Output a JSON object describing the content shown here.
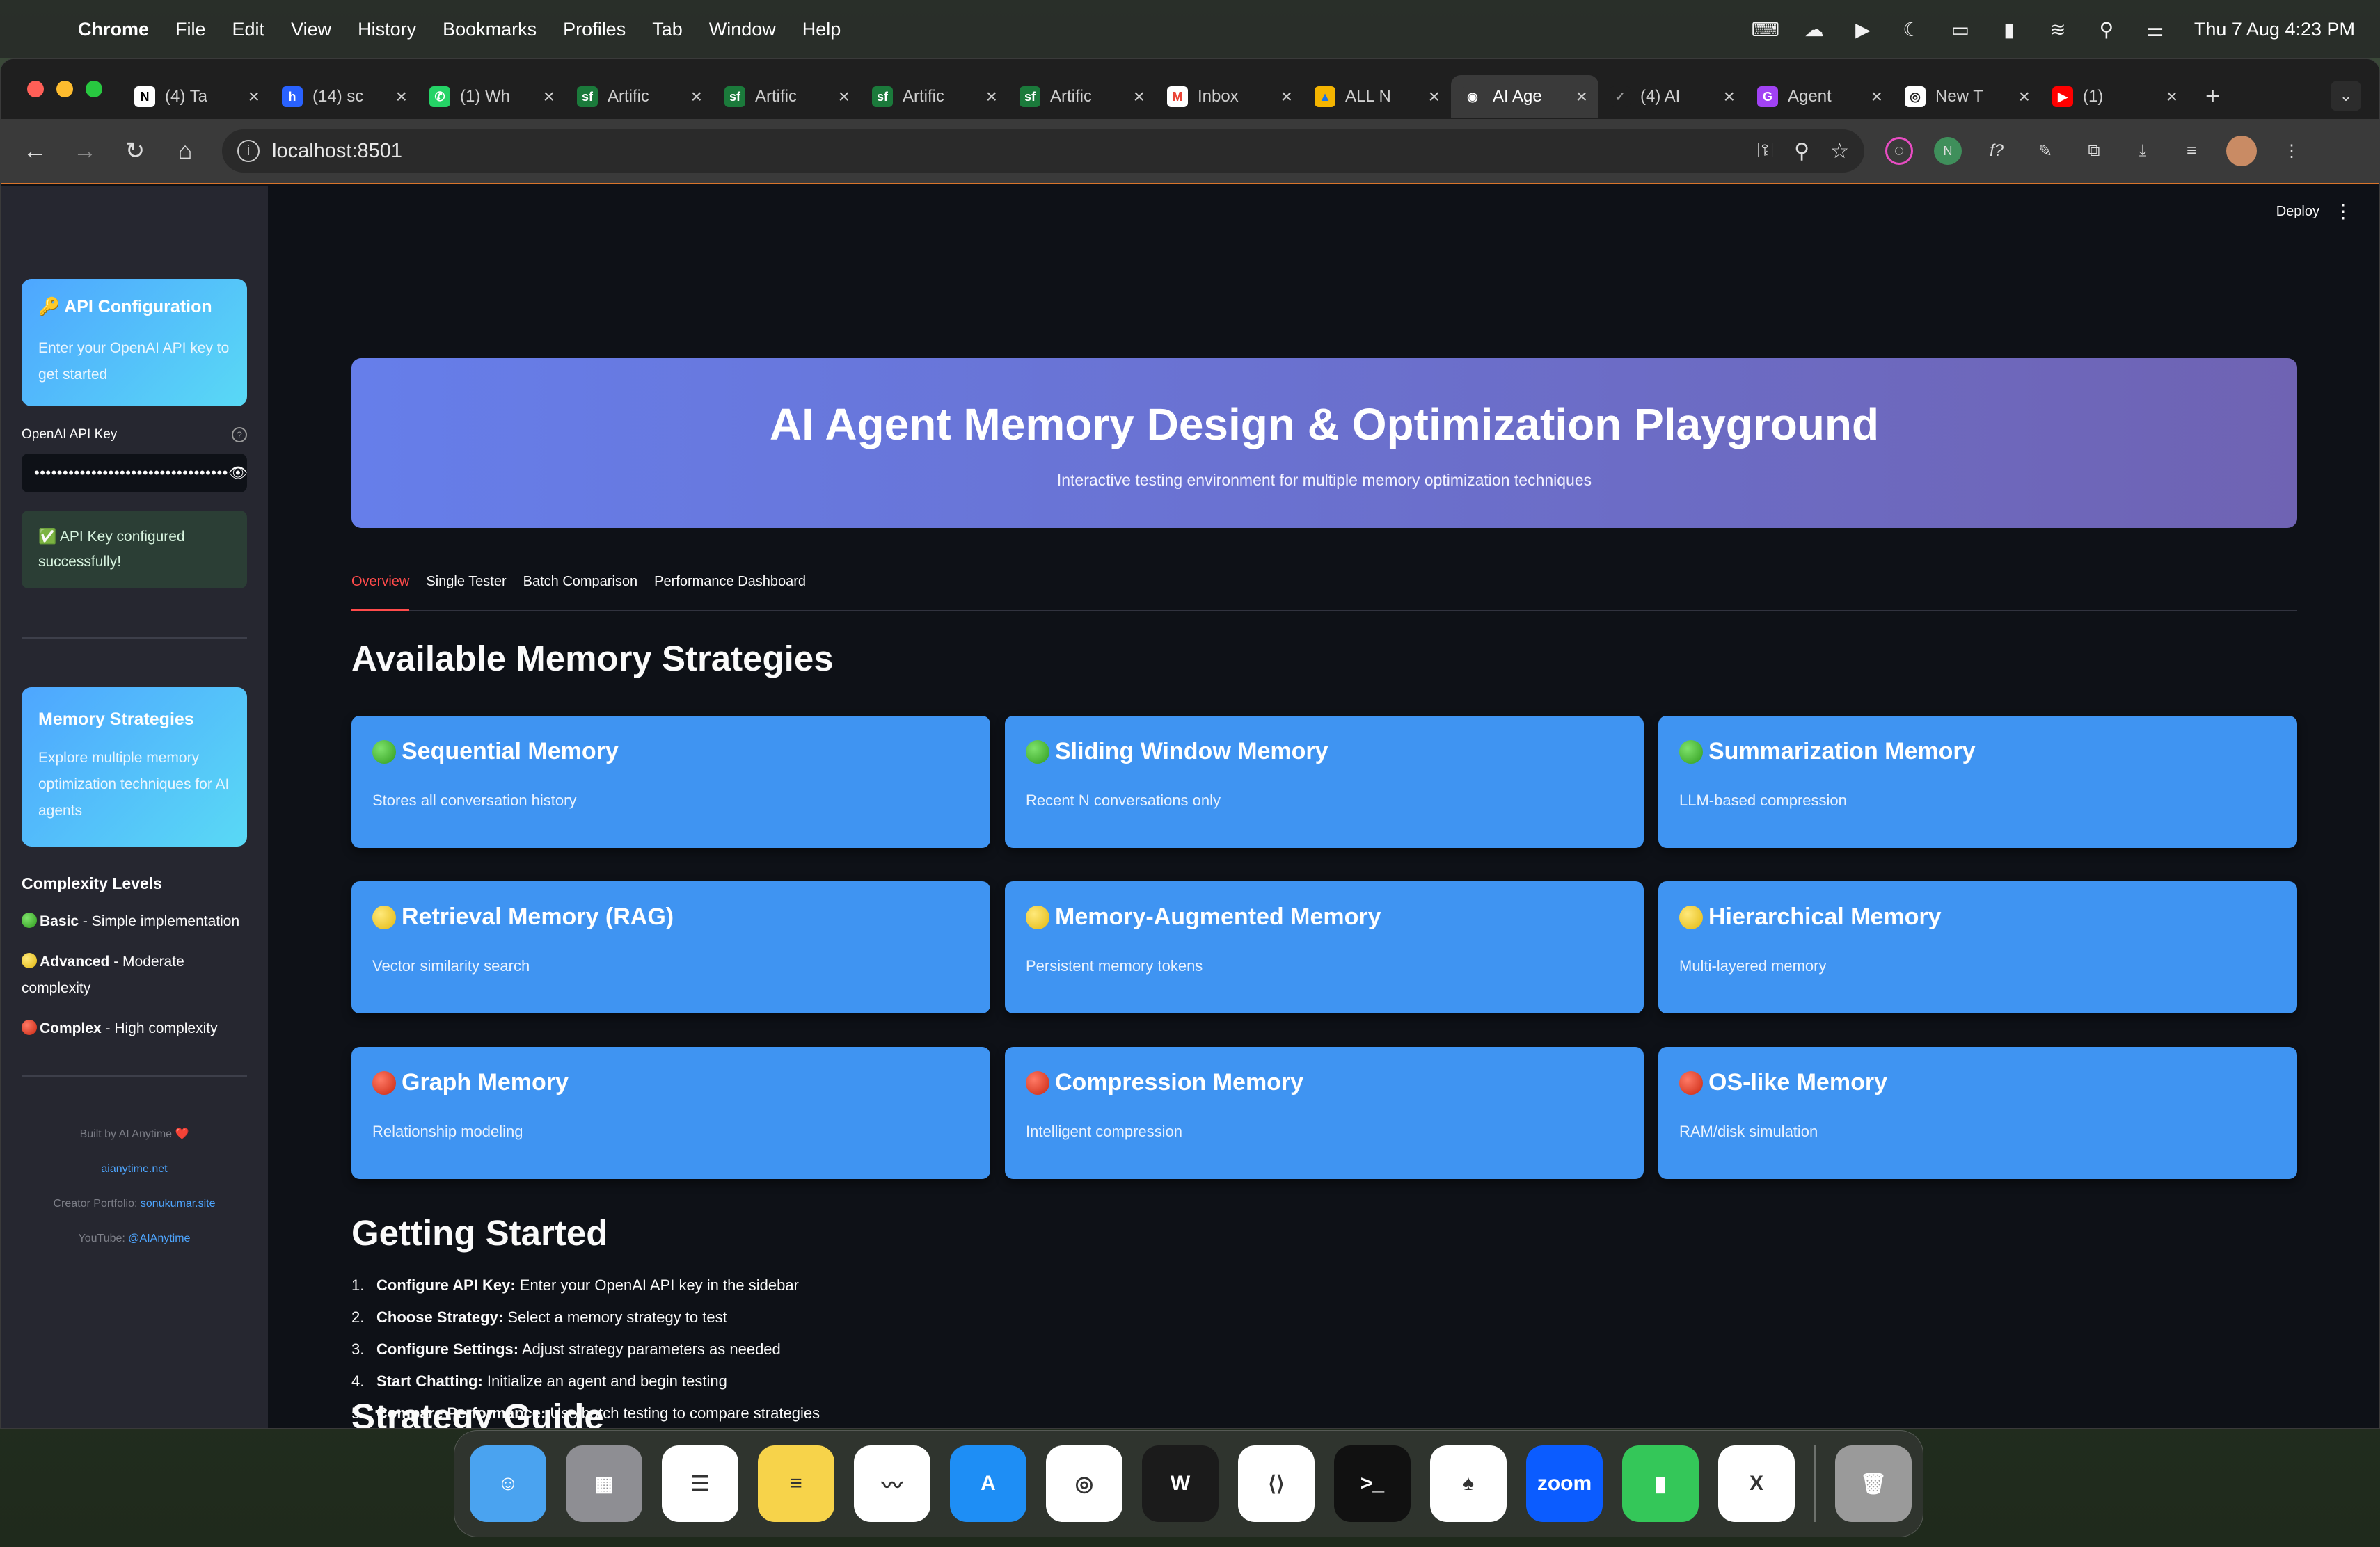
{
  "menubar": {
    "app_name": "Chrome",
    "items": [
      "File",
      "Edit",
      "View",
      "History",
      "Bookmarks",
      "Profiles",
      "Tab",
      "Window",
      "Help"
    ],
    "clock": "Thu 7 Aug  4:23 PM"
  },
  "browser": {
    "tabs": [
      {
        "title": "(4) Ta",
        "icon": "notion-icon",
        "color": "#ffffff",
        "fg": "#000000",
        "glyph": "N"
      },
      {
        "title": "(14) sc",
        "icon": "hashnode-icon",
        "color": "#2962ff",
        "fg": "#ffffff",
        "glyph": "h"
      },
      {
        "title": "(1) Wh",
        "icon": "whatsapp-icon",
        "color": "#25d366",
        "fg": "#ffffff",
        "glyph": "✆"
      },
      {
        "title": "Artific",
        "icon": "salesforce-icon",
        "color": "#1b7a3b",
        "fg": "#ffffff",
        "glyph": "sf"
      },
      {
        "title": "Artific",
        "icon": "salesforce-icon",
        "color": "#1b7a3b",
        "fg": "#ffffff",
        "glyph": "sf"
      },
      {
        "title": "Artific",
        "icon": "salesforce-icon",
        "color": "#1b7a3b",
        "fg": "#ffffff",
        "glyph": "sf"
      },
      {
        "title": "Artific",
        "icon": "salesforce-icon",
        "color": "#1b7a3b",
        "fg": "#ffffff",
        "glyph": "sf"
      },
      {
        "title": "Inbox",
        "icon": "gmail-icon",
        "color": "#ffffff",
        "fg": "#ea4335",
        "glyph": "M"
      },
      {
        "title": "ALL N",
        "icon": "drive-icon",
        "color": "#f4b400",
        "fg": "#1a73e8",
        "glyph": "▲"
      },
      {
        "title": "AI Age",
        "icon": "streamlit-icon",
        "color": "#3a3a3a",
        "fg": "#ffffff",
        "glyph": "◉",
        "active": true
      },
      {
        "title": "(4) AI",
        "icon": "check-icon",
        "color": "#1f1f1f",
        "fg": "#999999",
        "glyph": "✓"
      },
      {
        "title": "Agent",
        "icon": "g-icon",
        "color": "#a142f4",
        "fg": "#ffffff",
        "glyph": "G"
      },
      {
        "title": "New T",
        "icon": "chrome-icon",
        "color": "#ffffff",
        "fg": "#1f1f1f",
        "glyph": "◎"
      },
      {
        "title": "(1)",
        "icon": "youtube-icon",
        "color": "#ff0000",
        "fg": "#ffffff",
        "glyph": "▶"
      }
    ],
    "url": "localhost:8501"
  },
  "app": {
    "deploy_label": "Deploy",
    "sidebar": {
      "api_card": {
        "title": "🔑 API Configuration",
        "text": "Enter your OpenAI API key to get started"
      },
      "api_key_label": "OpenAI API Key",
      "api_key_value": "••••••••••••••••••••••••••••••••••",
      "success_text": "✅ API Key configured successfully!",
      "strategies_card": {
        "title": "Memory Strategies",
        "text": "Explore multiple memory optimization techniques for AI agents"
      },
      "complexity_title": "Complexity Levels",
      "complexity": [
        {
          "level": "green",
          "name": "Basic",
          "desc": " - Simple implementation"
        },
        {
          "level": "yellow",
          "name": "Advanced",
          "desc": " - Moderate complexity"
        },
        {
          "level": "red",
          "name": "Complex",
          "desc": " - High complexity"
        }
      ],
      "footer": {
        "built_by": "Built by AI Anytime ❤️",
        "site": "aianytime.net",
        "portfolio_label": "Creator Portfolio: ",
        "portfolio_link": "sonukumar.site",
        "youtube_label": "YouTube: ",
        "youtube_link": "@AIAnytime"
      }
    },
    "hero": {
      "title": "AI Agent Memory Design & Optimization Playground",
      "subtitle": "Interactive testing environment for multiple memory optimization techniques"
    },
    "tabs": [
      "Overview",
      "Single Tester",
      "Batch Comparison",
      "Performance Dashboard"
    ],
    "strategies_heading": "Available Memory Strategies",
    "strategies": [
      {
        "level": "green",
        "name": "Sequential Memory",
        "desc": "Stores all conversation history"
      },
      {
        "level": "green",
        "name": "Sliding Window Memory",
        "desc": "Recent N conversations only"
      },
      {
        "level": "green",
        "name": "Summarization Memory",
        "desc": "LLM-based compression"
      },
      {
        "level": "yellow",
        "name": "Retrieval Memory (RAG)",
        "desc": "Vector similarity search"
      },
      {
        "level": "yellow",
        "name": "Memory-Augmented Memory",
        "desc": "Persistent memory tokens"
      },
      {
        "level": "yellow",
        "name": "Hierarchical Memory",
        "desc": "Multi-layered memory"
      },
      {
        "level": "red",
        "name": "Graph Memory",
        "desc": "Relationship modeling"
      },
      {
        "level": "red",
        "name": "Compression Memory",
        "desc": "Intelligent compression"
      },
      {
        "level": "red",
        "name": "OS-like Memory",
        "desc": "RAM/disk simulation"
      }
    ],
    "getting_started_heading": "Getting Started",
    "steps": [
      {
        "label": "Configure API Key:",
        "text": " Enter your OpenAI API key in the sidebar"
      },
      {
        "label": "Choose Strategy:",
        "text": " Select a memory strategy to test"
      },
      {
        "label": "Configure Settings:",
        "text": " Adjust strategy parameters as needed"
      },
      {
        "label": "Start Chatting:",
        "text": " Initialize an agent and begin testing"
      },
      {
        "label": "Compare Performance:",
        "text": " Use batch testing to compare strategies"
      }
    ],
    "strategy_guide_heading": "Strategy Guide"
  },
  "dock": [
    {
      "name": "finder-icon",
      "color": "#4aa3f0",
      "glyph": "☺"
    },
    {
      "name": "launchpad-icon",
      "color": "#8e8e93",
      "glyph": "▦"
    },
    {
      "name": "reminders-icon",
      "color": "#ffffff",
      "glyph": "☰"
    },
    {
      "name": "notes-icon",
      "color": "#f7d34a",
      "glyph": "≡"
    },
    {
      "name": "freeform-icon",
      "color": "#ffffff",
      "glyph": "〰"
    },
    {
      "name": "app-store-icon",
      "color": "#1e8ef5",
      "glyph": "A"
    },
    {
      "name": "chrome-icon",
      "color": "#ffffff",
      "glyph": "◎"
    },
    {
      "name": "warp-icon",
      "color": "#1b1b1b",
      "glyph": "W"
    },
    {
      "name": "vscode-icon",
      "color": "#ffffff",
      "glyph": "⟨⟩"
    },
    {
      "name": "terminal-icon",
      "color": "#111111",
      "glyph": ">_"
    },
    {
      "name": "mongodb-icon",
      "color": "#ffffff",
      "glyph": "♠"
    },
    {
      "name": "zoom-icon",
      "color": "#0b5cff",
      "glyph": "zoom"
    },
    {
      "name": "numbers-icon",
      "color": "#34c759",
      "glyph": "▮"
    },
    {
      "name": "x-icon",
      "color": "#ffffff",
      "glyph": "X"
    },
    {
      "name": "trash-icon",
      "color": "#9a9a9a",
      "glyph": "🗑"
    }
  ]
}
